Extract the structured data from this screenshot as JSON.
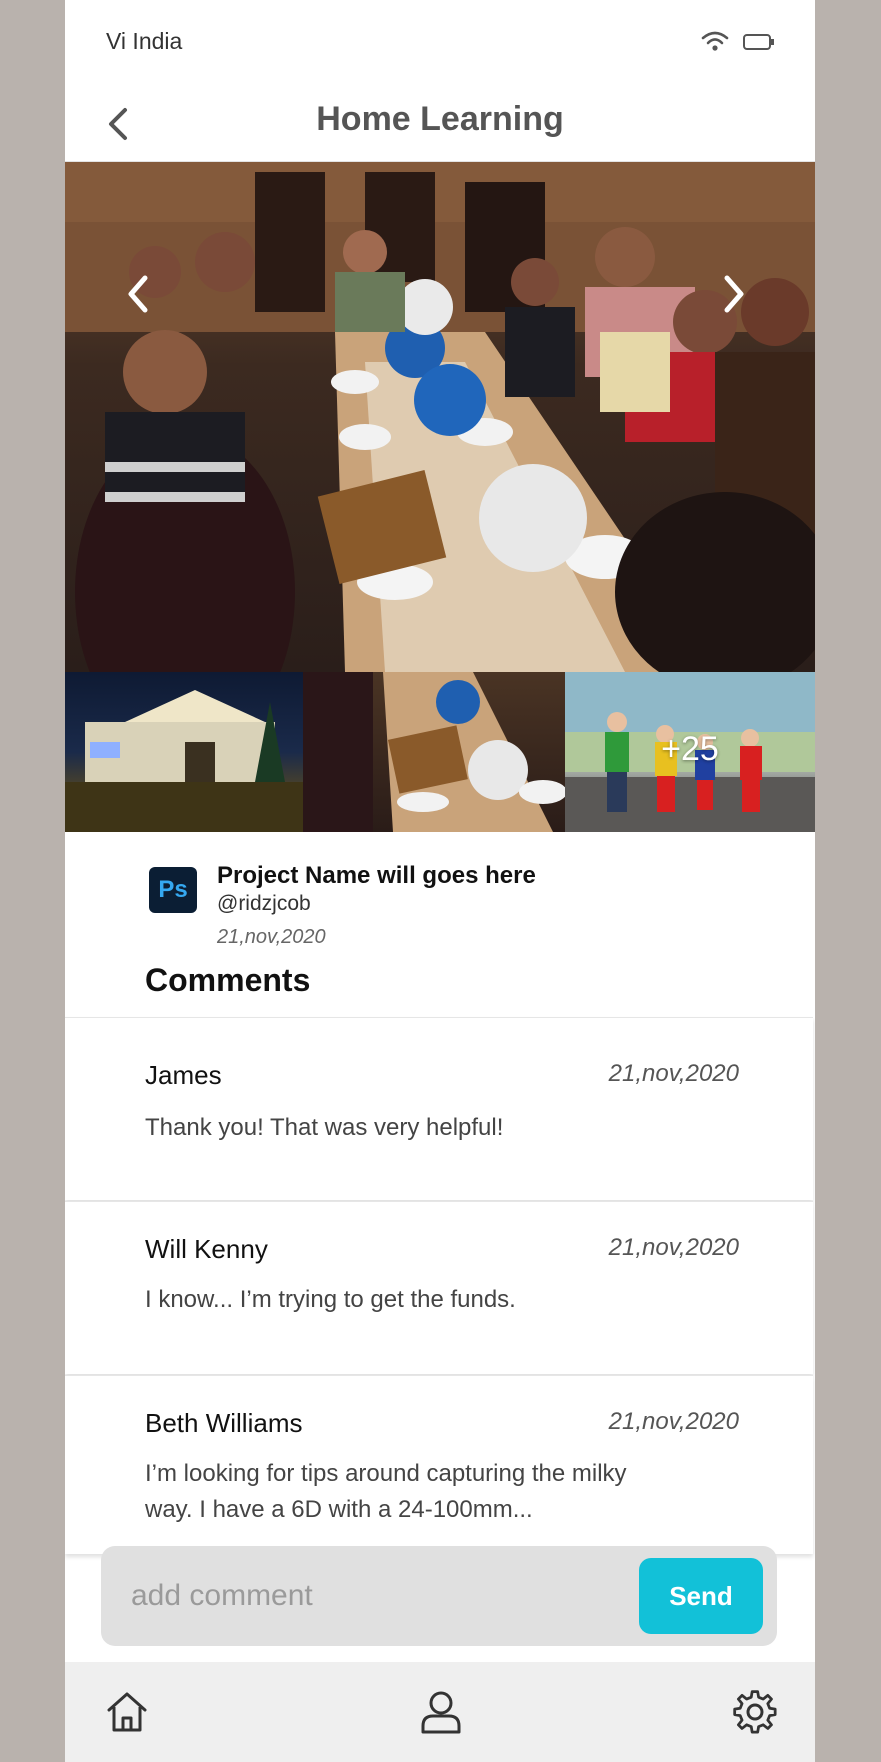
{
  "status_bar": {
    "carrier": "Vi India",
    "wifi_icon": "wifi-icon",
    "battery_icon": "battery-icon"
  },
  "header": {
    "title": "Home Learning",
    "back_icon": "chevron-left-icon"
  },
  "gallery": {
    "prev_icon": "chevron-left-icon",
    "next_icon": "chevron-right-icon",
    "more_count": "+25"
  },
  "project": {
    "logo_text": "Ps",
    "name": "Project Name will goes here",
    "handle": "@ridzjcob",
    "date": "21,nov,2020"
  },
  "comments_heading": "Comments",
  "comments": [
    {
      "author": "James",
      "date": "21,nov,2020",
      "text": "Thank you! That was very helpful!"
    },
    {
      "author": "Will Kenny",
      "date": "21,nov,2020",
      "text": "I know... I’m trying to get the funds."
    },
    {
      "author": "Beth Williams",
      "date": "21,nov,2020",
      "text": "I’m looking for tips around capturing the milky way. I have a 6D with a 24-100mm..."
    }
  ],
  "comment_bar": {
    "placeholder": "add comment",
    "send_label": "Send"
  },
  "bottom_nav": {
    "home_icon": "home-icon",
    "profile_icon": "user-icon",
    "settings_icon": "gear-icon"
  },
  "colors": {
    "accent": "#12c1d8",
    "background": "#b9b2ad",
    "nav_background": "#efefef"
  }
}
